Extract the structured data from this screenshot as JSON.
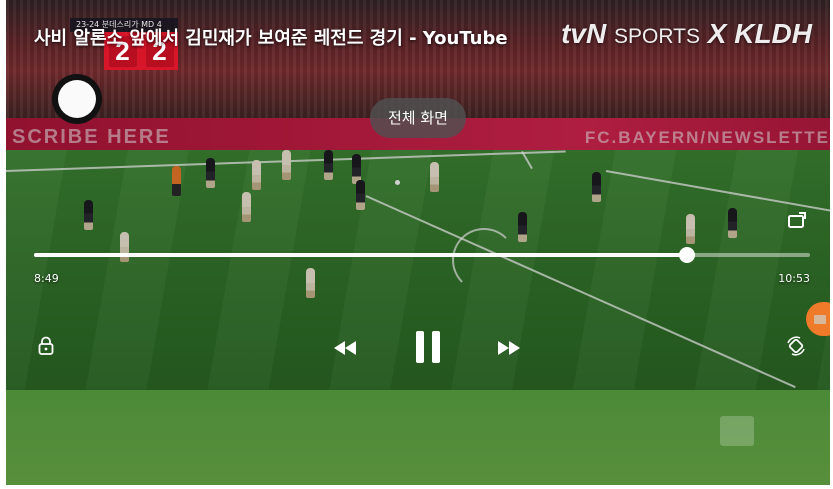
{
  "video": {
    "title": "사비 알론소 앞에서 김민재가 보여준 레전드 경기 - YouTube",
    "broadcaster_main": "tvN",
    "broadcaster_sports": "SPORTS",
    "broadcaster_x": "X",
    "broadcaster_partner": "KLDH"
  },
  "scoreboard": {
    "meta": "23-24 분데스리가 MD 4",
    "home_score": "2",
    "away_score": "2"
  },
  "ads": {
    "left": "SCRIBE HERE",
    "right": "FC.BAYERN/NEWSLETTE"
  },
  "tooltip": {
    "label": "전체 화면"
  },
  "player": {
    "current_time": "8:49",
    "duration": "10:53",
    "progress_fraction": 0.8415,
    "state": "playing"
  },
  "icons": {
    "lock": "lock-icon",
    "rewind": "rewind-icon",
    "pause": "pause-icon",
    "fast_forward": "fast-forward-icon",
    "fullscreen": "fullscreen-icon",
    "rotate": "rotate-icon"
  },
  "colors": {
    "accent": "#ffffff",
    "score_red": "#d8162a",
    "side_tab": "#ee7a2a"
  }
}
